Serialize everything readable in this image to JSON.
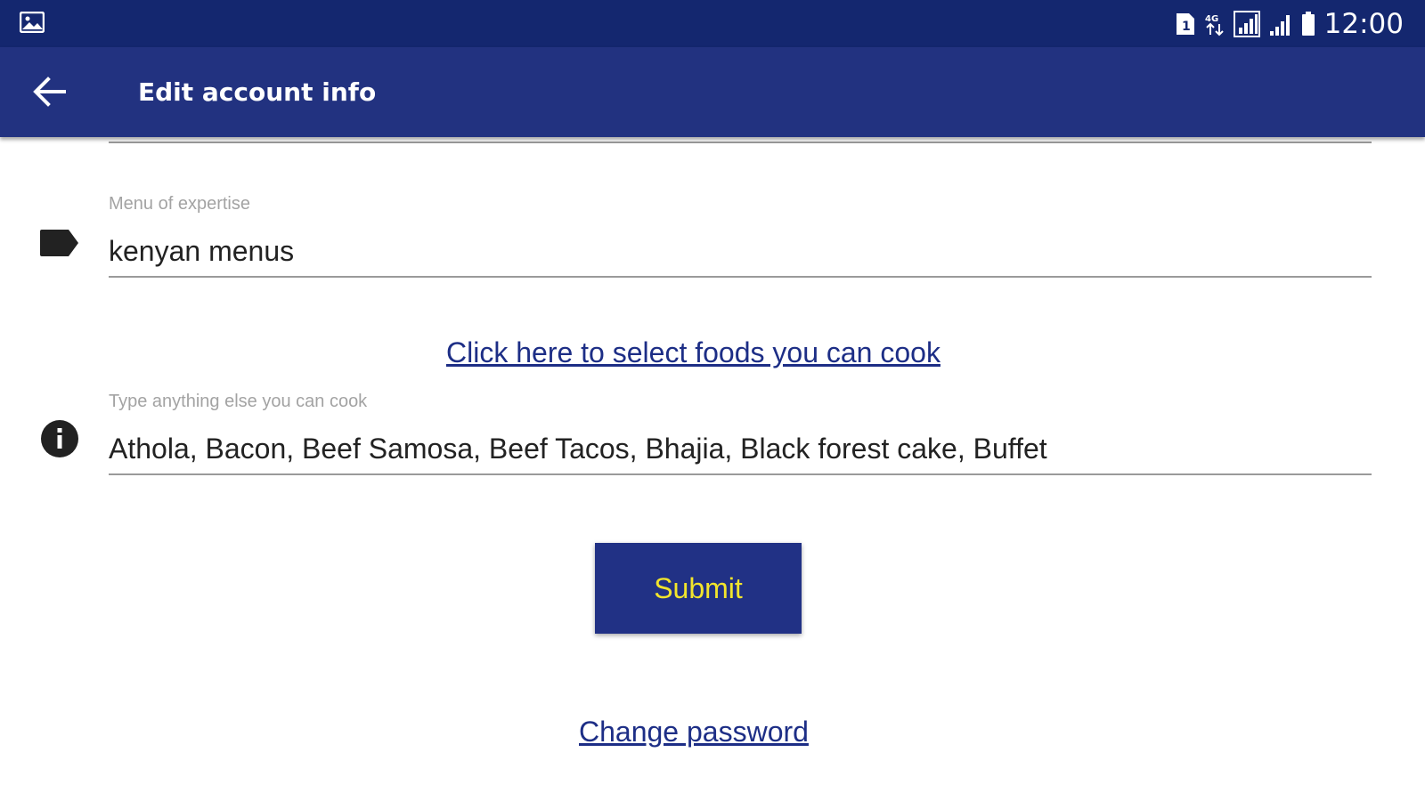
{
  "status_bar": {
    "time": "12:00",
    "icons": [
      "gallery-notification-icon",
      "sim-card-icon",
      "data-arrows-icon",
      "signal-icon",
      "signal-weak-icon",
      "battery-icon"
    ]
  },
  "app_bar": {
    "title": "Edit account info",
    "back_icon": "arrow-left-icon"
  },
  "form": {
    "menu_expertise": {
      "label": "Menu of expertise",
      "value": "kenyan menus",
      "icon": "label-tag-icon"
    },
    "select_foods_link": "Click here to select foods you can cook",
    "other_foods": {
      "label": "Type anything else you can cook",
      "value": "Athola, Bacon, Beef Samosa, Beef Tacos, Bhajia, Black forest cake, Buffet",
      "icon": "info-icon"
    },
    "submit_label": "Submit",
    "change_password_link": "Change password"
  },
  "colors": {
    "status_bar": "#14276f",
    "app_bar": "#223280",
    "button_bg": "#213185",
    "button_text": "#f2e52c",
    "link": "#1d2e86"
  }
}
